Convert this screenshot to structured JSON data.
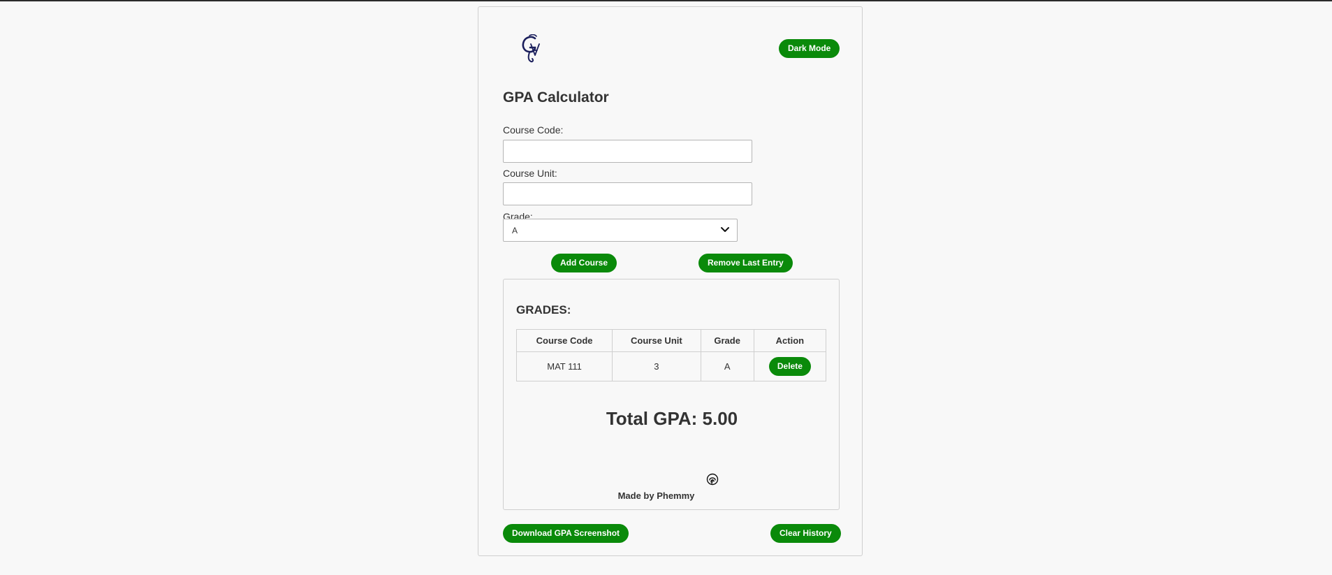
{
  "header": {
    "logo_text": "GA",
    "dark_mode_label": "Dark Mode"
  },
  "form": {
    "title": "GPA Calculator",
    "course_code_label": "Course Code:",
    "course_code_value": "",
    "course_unit_label": "Course Unit:",
    "course_unit_value": "",
    "grade_label": "Grade:",
    "grade_selected": "A",
    "add_course_label": "Add Course",
    "remove_last_label": "Remove Last Entry"
  },
  "grades": {
    "title": "GRADES:",
    "columns": [
      "Course Code",
      "Course Unit",
      "Grade",
      "Action"
    ],
    "rows": [
      {
        "code": "MAT 111",
        "unit": "3",
        "grade": "A",
        "action": "Delete"
      }
    ],
    "total_gpa": "Total GPA: 5.00",
    "credit": "Made by Phemmy"
  },
  "footer": {
    "download_label": "Download GPA Screenshot",
    "clear_label": "Clear History"
  },
  "colors": {
    "accent": "#0a8a0a",
    "logo": "#1b1f5c",
    "background": "#f8f8f8",
    "text": "#333333"
  },
  "icons": {
    "logo": "ga-logo-icon",
    "select": "chevron-down-icon",
    "credit": "fingerprint-icon"
  }
}
